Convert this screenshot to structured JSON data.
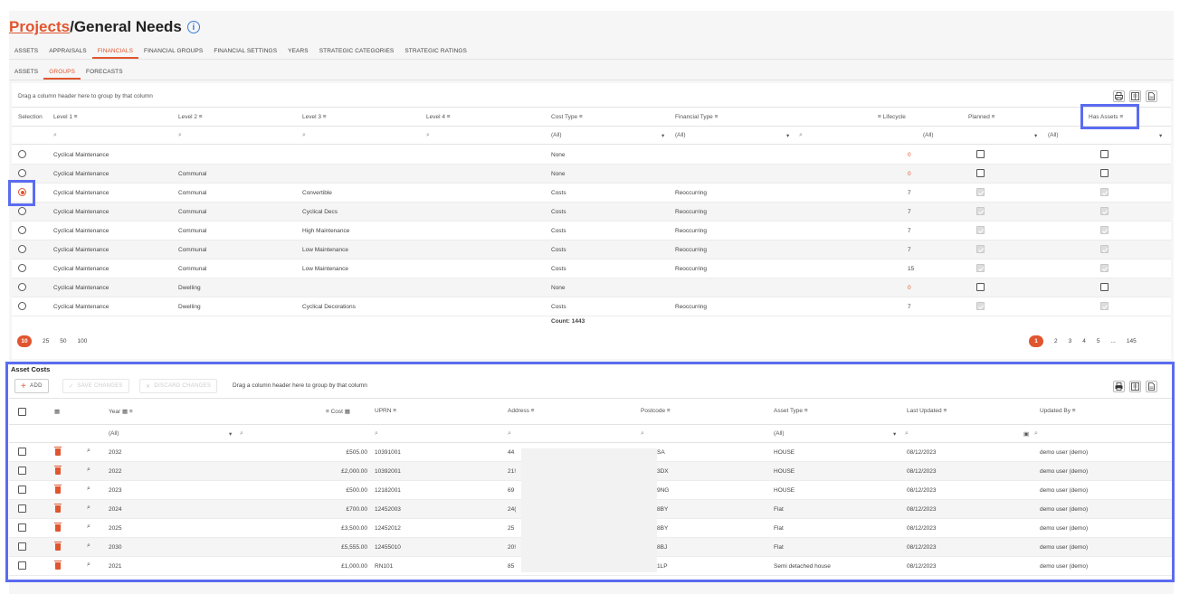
{
  "header": {
    "crumb": "Projects",
    "sep": "/",
    "title": "General Needs",
    "info": "i"
  },
  "tabs_main": [
    "ASSETS",
    "APPRAISALS",
    "FINANCIALS",
    "FINANCIAL GROUPS",
    "FINANCIAL SETTINGS",
    "YEARS",
    "STRATEGIC CATEGORIES",
    "STRATEGIC RATINGS"
  ],
  "tabs_sub": [
    "ASSETS",
    "GROUPS",
    "FORECASTS"
  ],
  "groups": {
    "hint": "Drag a column header here to group by that column",
    "headers": {
      "selection": "Selection",
      "level1": "Level 1",
      "level2": "Level 2",
      "level3": "Level 3",
      "level4": "Level 4",
      "cost_type": "Cost Type",
      "financial_type": "Financial Type",
      "lifecycle": "Lifecycle",
      "planned": "Planned",
      "has_assets": "Has Assets"
    },
    "filters": {
      "cost_type": "(All)",
      "financial_type": "(All)",
      "planned": "(All)",
      "has_assets": "(All)"
    },
    "rows": [
      {
        "l1": "Cyclical Maintenance",
        "l2": "",
        "l3": "",
        "ct": "None",
        "ft": "",
        "lc": "0",
        "lc_color": "#e0552f"
      },
      {
        "l1": "Cyclical Maintenance",
        "l2": "Communal",
        "l3": "",
        "ct": "None",
        "ft": "",
        "lc": "0",
        "lc_color": "#e0552f"
      },
      {
        "l1": "Cyclical Maintenance",
        "l2": "Communal",
        "l3": "Convertible",
        "ct": "Costs",
        "ft": "Reoccurring",
        "lc": "7",
        "lc_color": "#444"
      },
      {
        "l1": "Cyclical Maintenance",
        "l2": "Communal",
        "l3": "Cyclical Decs",
        "ct": "Costs",
        "ft": "Reoccurring",
        "lc": "7",
        "lc_color": "#444"
      },
      {
        "l1": "Cyclical Maintenance",
        "l2": "Communal",
        "l3": "High Maintenance",
        "ct": "Costs",
        "ft": "Reoccurring",
        "lc": "7",
        "lc_color": "#444"
      },
      {
        "l1": "Cyclical Maintenance",
        "l2": "Communal",
        "l3": "Low Maintenance",
        "ct": "Costs",
        "ft": "Reoccurring",
        "lc": "7",
        "lc_color": "#444"
      },
      {
        "l1": "Cyclical Maintenance",
        "l2": "Communal",
        "l3": "Low Maintenance",
        "ct": "Costs",
        "ft": "Reoccurring",
        "lc": "15",
        "lc_color": "#444"
      },
      {
        "l1": "Cyclical Maintenance",
        "l2": "Dwelling",
        "l3": "",
        "ct": "None",
        "ft": "",
        "lc": "0",
        "lc_color": "#e0552f"
      },
      {
        "l1": "Cyclical Maintenance",
        "l2": "Dwelling",
        "l3": "Cyclical Decorations",
        "ct": "Costs",
        "ft": "Reoccurring",
        "lc": "7",
        "lc_color": "#444"
      }
    ],
    "count": "Count: 1443",
    "page_sizes": [
      "10",
      "25",
      "50",
      "100"
    ],
    "pages": [
      "1",
      "2",
      "3",
      "4",
      "5",
      "...",
      "145"
    ]
  },
  "asset_costs": {
    "title": "Asset Costs",
    "add_label": "ADD",
    "save_label": "SAVE CHANGES",
    "discard_label": "DISCARD CHANGES",
    "hint": "Drag a column header here to group by that column",
    "headers": {
      "year": "Year",
      "cost": "Cost",
      "uprn": "UPRN",
      "address": "Address",
      "postcode": "Postcode",
      "asset_type": "Asset Type",
      "last_updated": "Last Updated",
      "updated_by": "Updated By"
    },
    "filters": {
      "year": "(All)",
      "asset_type": "(All)"
    },
    "rows": [
      {
        "year": "2032",
        "cost": "£505.00",
        "uprn": "10391001",
        "addr": "44",
        "pc": "SA",
        "type": "HOUSE",
        "date": "08/12/2023",
        "by": "demo user (demo)"
      },
      {
        "year": "2022",
        "cost": "£2,000.00",
        "uprn": "10392001",
        "addr": "21!",
        "pc": "3DX",
        "type": "HOUSE",
        "date": "08/12/2023",
        "by": "demo user (demo)"
      },
      {
        "year": "2023",
        "cost": "£500.00",
        "uprn": "12182001",
        "addr": "69",
        "pc": "9NG",
        "type": "HOUSE",
        "date": "08/12/2023",
        "by": "demo user (demo)"
      },
      {
        "year": "2024",
        "cost": "£700.00",
        "uprn": "12452003",
        "addr": "24(",
        "pc": "8BY",
        "type": "Flat",
        "date": "08/12/2023",
        "by": "demo user (demo)"
      },
      {
        "year": "2025",
        "cost": "£3,500.00",
        "uprn": "12452012",
        "addr": "25",
        "pc": "8BY",
        "type": "Flat",
        "date": "08/12/2023",
        "by": "demo user (demo)"
      },
      {
        "year": "2030",
        "cost": "£5,555.00",
        "uprn": "12455010",
        "addr": "20!",
        "pc": "8BJ",
        "type": "Flat",
        "date": "08/12/2023",
        "by": "demo user (demo)"
      },
      {
        "year": "2021",
        "cost": "£1,000.00",
        "uprn": "RN101",
        "addr": "85",
        "pc": "1LP",
        "type": "Semi detached house",
        "date": "08/12/2023",
        "by": "demo user (demo)"
      }
    ]
  },
  "colors": {
    "accent": "#e0552f",
    "highlight": "#5b6cf0"
  }
}
